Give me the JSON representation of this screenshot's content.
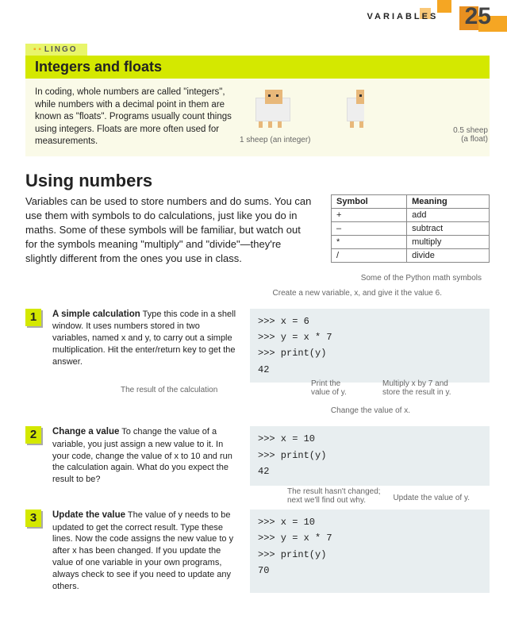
{
  "header": {
    "label": "VARIABLES",
    "page": "25"
  },
  "lingo": {
    "tab": "LINGO",
    "title": "Integers and floats",
    "body": "In coding, whole numbers are called \"integers\", while numbers with a decimal point in them are known as \"floats\". Programs usually count things using integers. Floats are more often used for measurements.",
    "caption1": "1 sheep (an integer)",
    "caption2_a": "0.5 sheep",
    "caption2_b": "(a float)"
  },
  "section": {
    "title": "Using numbers",
    "intro": "Variables can be used to store numbers and do sums. You can use them with symbols to do calculations, just like you do in maths. Some of these symbols will be familiar, but watch out for the symbols meaning \"multiply\" and \"divide\"—they're slightly different from the ones you use in class."
  },
  "table": {
    "h1": "Symbol",
    "h2": "Meaning",
    "rows": [
      {
        "sym": "+",
        "mean": "add"
      },
      {
        "sym": "–",
        "mean": "subtract"
      },
      {
        "sym": "*",
        "mean": "multiply"
      },
      {
        "sym": "/",
        "mean": "divide"
      }
    ],
    "caption": "Some of the Python math symbols"
  },
  "steps": [
    {
      "num": "1",
      "title": "A simple calculation",
      "body": "Type this code in a shell window. It uses numbers stored in two variables, named x and y, to carry out a simple multiplication. Hit the enter/return key to get the answer.",
      "code": ">>> x = 6\n>>> y = x * 7\n>>> print(y)\n42",
      "annots": {
        "top": "Create a new variable, x, and give it the value 6.",
        "left": "The result of the calculation",
        "mid": "Print the\nvalue of y.",
        "right": "Multiply x by 7 and\nstore the result in y."
      }
    },
    {
      "num": "2",
      "title": "Change a value",
      "body": "To change the value of a variable, you just assign a new value to it. In your code, change the value of x to 10 and run the calculation again. What do you expect the result to be?",
      "code": ">>> x = 10\n>>> print(y)\n42",
      "annots": {
        "top": "Change the value of x.",
        "bottom": "The result hasn't changed;\nnext we'll find out why."
      }
    },
    {
      "num": "3",
      "title": "Update the value",
      "body": "The value of y needs to be updated to get the correct result. Type these lines. Now the code assigns the new value to y after x has been changed. If you update the value of one variable in your own programs, always check to see if you need to update any others.",
      "code": ">>> x = 10\n>>> y = x * 7\n>>> print(y)\n70",
      "annots": {
        "right": "Update the value of y."
      }
    }
  ]
}
